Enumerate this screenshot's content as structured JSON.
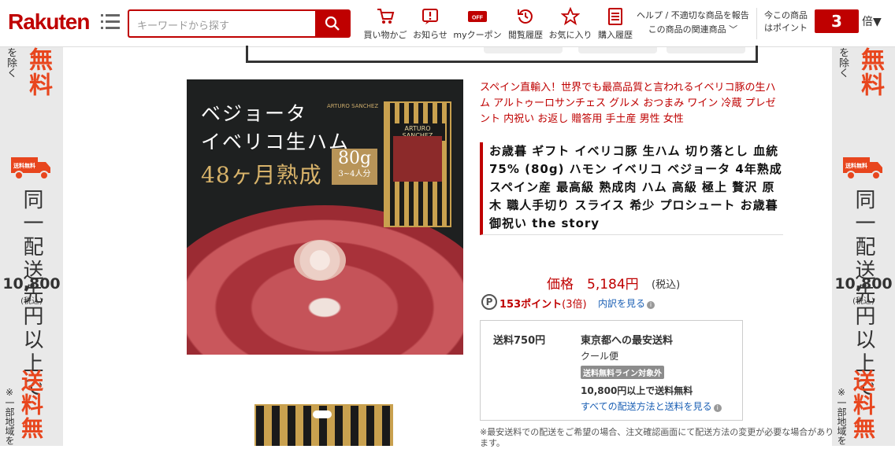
{
  "header": {
    "logo": "Rakuten",
    "search_placeholder": "キーワードから探す",
    "nav": [
      {
        "label": "買い物かご",
        "icon": "cart-icon"
      },
      {
        "label": "お知らせ",
        "icon": "notice-icon"
      },
      {
        "label": "myクーポン",
        "icon": "coupon-icon"
      },
      {
        "label": "閲覧履歴",
        "icon": "history-icon"
      },
      {
        "label": "お気に入り",
        "icon": "star-icon"
      },
      {
        "label": "購入履歴",
        "icon": "purchase-history-icon"
      }
    ],
    "help_line1": "ヘルプ / 不適切な商品を報告",
    "help_line2": "この商品の関連商品",
    "points_label_1": "今この商品",
    "points_label_2": "はポイント",
    "points_value": "3",
    "points_suffix": "倍▼"
  },
  "side_banner": {
    "top_small": "を除く",
    "top_red": "無料",
    "truck_label": "送料無料",
    "line1": "同一配送先",
    "amount": "10,800",
    "tax": "(税込)",
    "line2": "円以上で",
    "red": "送料無",
    "note": "※一部地域を"
  },
  "product_image": {
    "title_line1": "ベジョータ",
    "title_line2": "イベリコ生ハム",
    "title_line3": "48ヶ月熟成",
    "weight": "80g",
    "servings": "3~4人分",
    "brand": "ARTURO SANCHEZ",
    "pack_label": "ARTURO SANCHEZ"
  },
  "product": {
    "tagline": "スペイン直輸入！世界でも最高品質と言われるイベリコ豚の生ハム アルトゥーロサンチェス グルメ おつまみ ワイン 冷蔵 プレゼント 内祝い お返し 贈答用 手土産 男性 女性",
    "title": "お歳暮 ギフト イベリコ豚 生ハム 切り落とし 血統75% (80g) ハモン イベリコ ベジョータ 4年熟成 スペイン産 最高級 熟成肉 ハム 高級 極上 贅沢 原木 職人手切り スライス 希少 プロシュート お歳暮 御祝い the story",
    "price_label": "価格　5,184円",
    "price_tax": "(税込)",
    "points_icon": "P",
    "points_text": "153ポイント",
    "points_multiplier": "(3倍)",
    "points_link": "内訳を見る"
  },
  "shipping": {
    "fee": "送料750円",
    "title": "東京都への最安送料",
    "method": "クール便",
    "badge": "送料無料ライン対象外",
    "free_line": "10,800円以上で送料無料",
    "link": "すべての配送方法と送料を見る"
  },
  "note": "※最安送料での配送をご希望の場合、注文確認画面にて配送方法の変更が必要な場合があります。"
}
